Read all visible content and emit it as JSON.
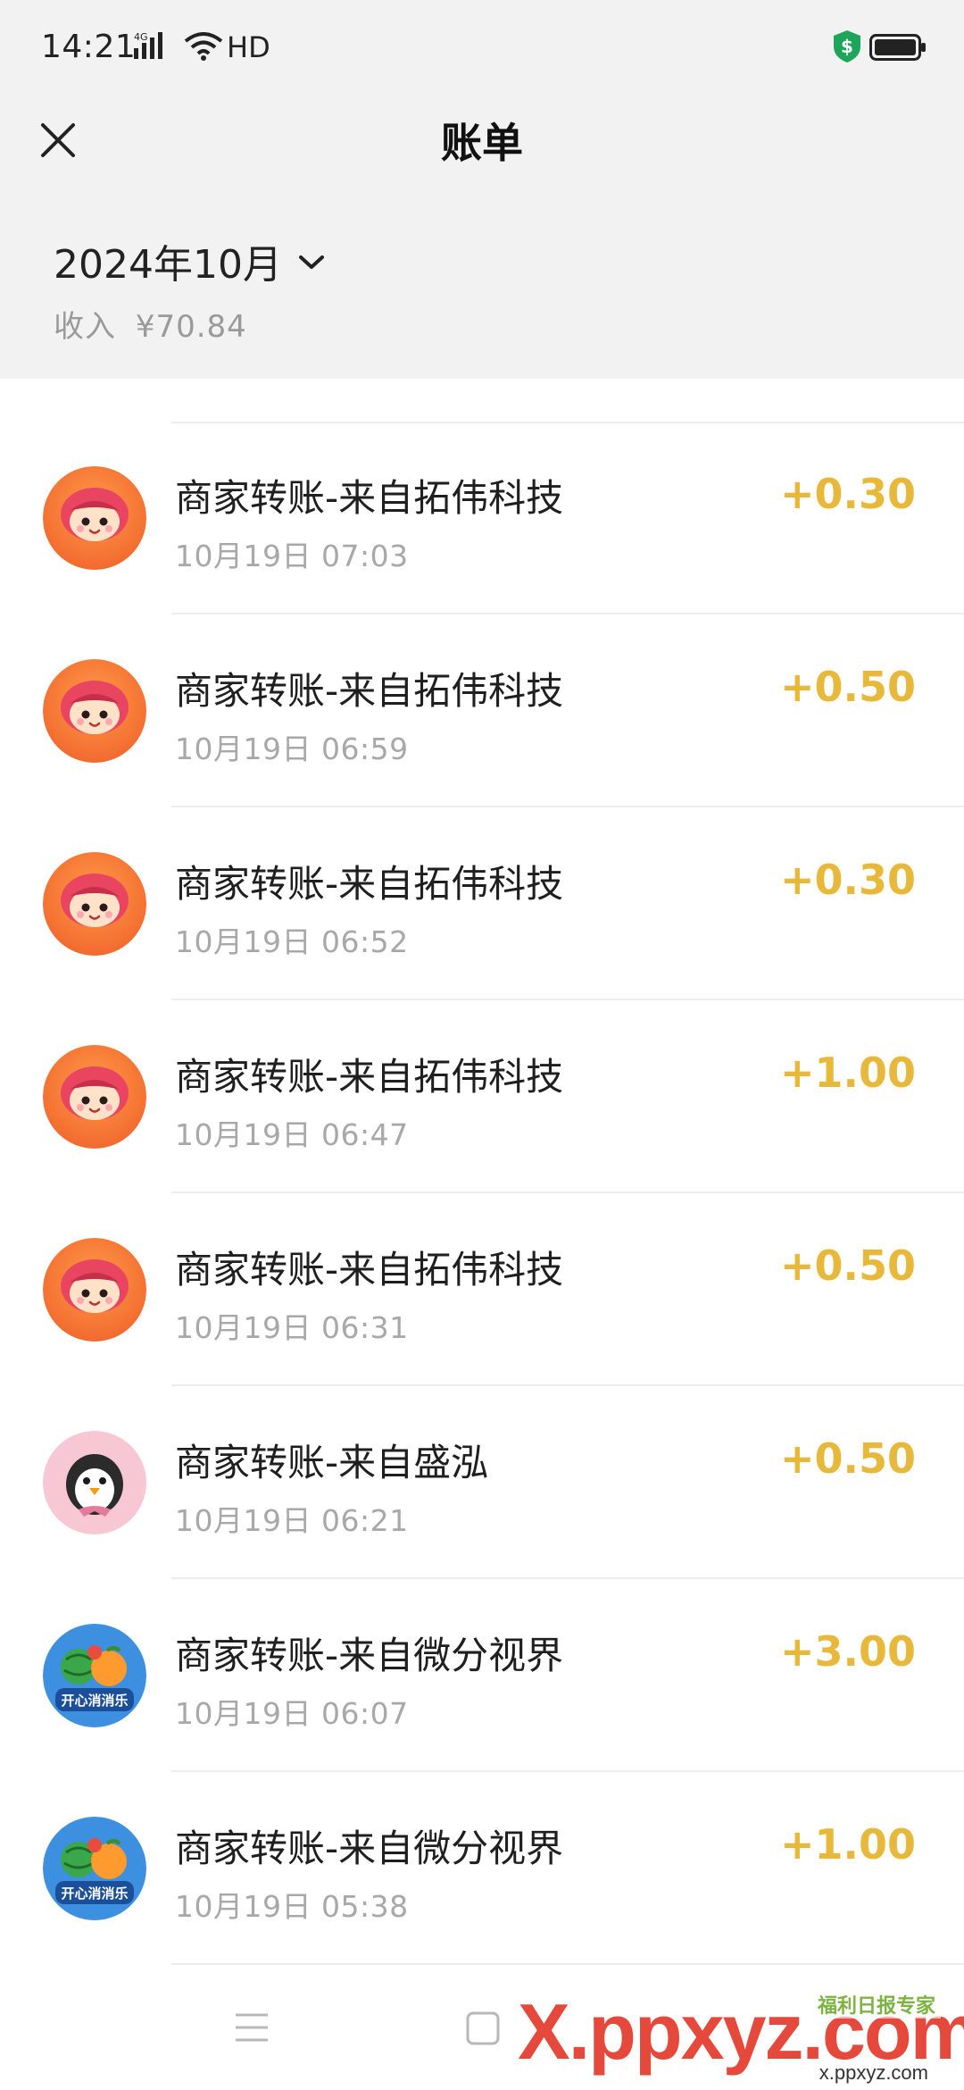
{
  "status_bar": {
    "time": "14:21",
    "network": "4G",
    "hd": "HD"
  },
  "nav": {
    "title": "账单",
    "close_icon": "close-icon"
  },
  "month": {
    "label": "2024年10月",
    "income_label": "收入",
    "income_value": "¥70.84"
  },
  "transactions": [
    {
      "title": "商家转账-来自拓伟科技",
      "time": "10月19日 07:03",
      "amount": "+0.30",
      "avatar": "cartoon-girl"
    },
    {
      "title": "商家转账-来自拓伟科技",
      "time": "10月19日 06:59",
      "amount": "+0.50",
      "avatar": "cartoon-girl"
    },
    {
      "title": "商家转账-来自拓伟科技",
      "time": "10月19日 06:52",
      "amount": "+0.30",
      "avatar": "cartoon-girl"
    },
    {
      "title": "商家转账-来自拓伟科技",
      "time": "10月19日 06:47",
      "amount": "+1.00",
      "avatar": "cartoon-girl"
    },
    {
      "title": "商家转账-来自拓伟科技",
      "time": "10月19日 06:31",
      "amount": "+0.50",
      "avatar": "cartoon-girl"
    },
    {
      "title": "商家转账-来自盛泓",
      "time": "10月19日 06:21",
      "amount": "+0.50",
      "avatar": "penguin"
    },
    {
      "title": "商家转账-来自微分视界",
      "time": "10月19日 06:07",
      "amount": "+3.00",
      "avatar": "fruit-game",
      "avatar_text": "开心消消乐"
    },
    {
      "title": "商家转账-来自微分视界",
      "time": "10月19日 05:38",
      "amount": "+1.00",
      "avatar": "fruit-game",
      "avatar_text": "开心消消乐"
    }
  ],
  "colors": {
    "amount": "#e8b83a",
    "header_bg": "#f2f2f2",
    "time_text": "#a8a8a8"
  },
  "watermark": {
    "text": "X.ppxyz.com",
    "sub": "福利日报专家",
    "url": "x.ppxyz.com"
  }
}
